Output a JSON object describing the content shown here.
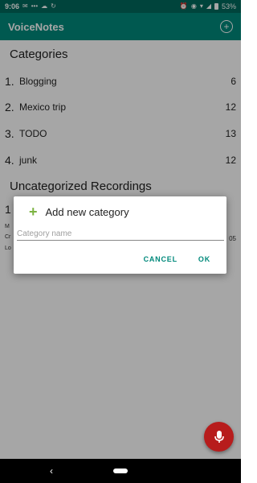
{
  "status_bar": {
    "time": "9:06",
    "battery": "53%",
    "icons": [
      "message-icon",
      "signal-dots-icon",
      "cloud-icon",
      "sync-icon",
      "alarm-icon",
      "eye-icon",
      "wifi-icon",
      "signal-icon",
      "battery-icon"
    ]
  },
  "app_bar": {
    "title": "VoiceNotes",
    "add_icon": "add-circle-icon"
  },
  "categories_section": {
    "header": "Categories",
    "items": [
      {
        "number": "1.",
        "name": "Blogging",
        "count": "6"
      },
      {
        "number": "2.",
        "name": "Mexico trip",
        "count": "12"
      },
      {
        "number": "3.",
        "name": "TODO",
        "count": "13"
      },
      {
        "number": "4.",
        "name": "junk",
        "count": "12"
      }
    ]
  },
  "uncategorized_section": {
    "header": "Uncategorized Recordings",
    "peek_number": "1",
    "meta_lines": [
      "M",
      "Cr",
      "Lo"
    ],
    "right_value": "05"
  },
  "dialog": {
    "title": "Add new category",
    "input_placeholder": "Category name",
    "input_value": "",
    "cancel_label": "CANCEL",
    "ok_label": "OK"
  },
  "fab": {
    "icon": "microphone-icon"
  },
  "nav_bar": {
    "back_icon": "back-icon",
    "home_icon": "home-pill-icon"
  },
  "colors": {
    "status_bar": "#00695c",
    "app_bar": "#00897b",
    "accent": "#00897b",
    "plus": "#7cb342",
    "fab": "#b71c1c"
  }
}
